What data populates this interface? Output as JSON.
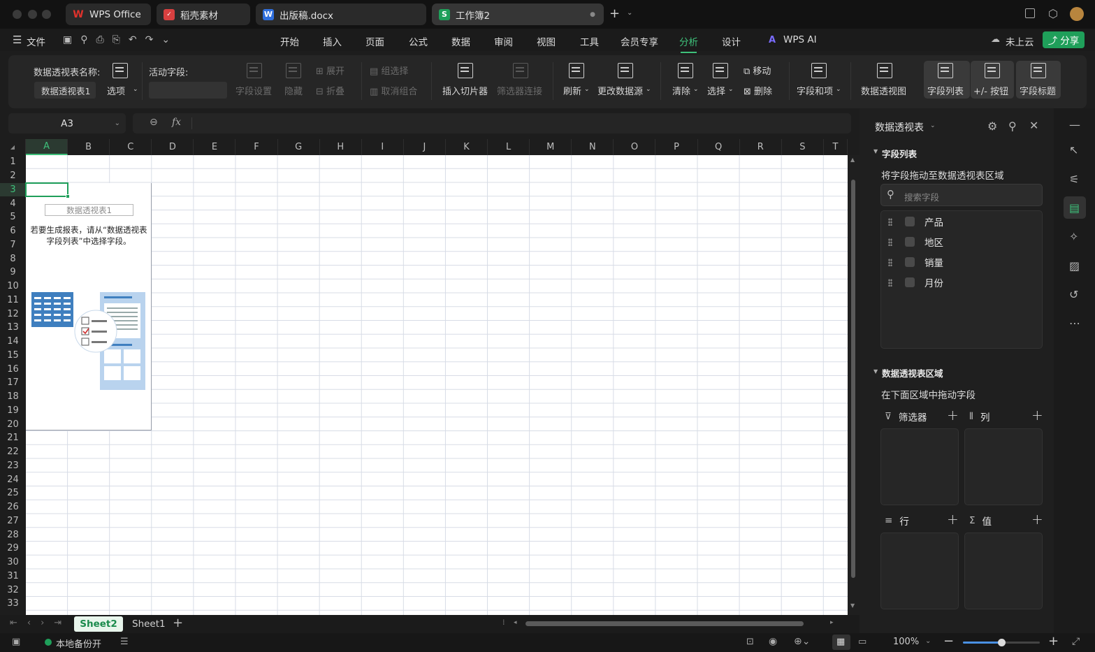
{
  "titlebar": {
    "tabs": [
      {
        "icon": "W",
        "label": "WPS Office",
        "color": "#e0322c"
      },
      {
        "icon": "稻",
        "label": "稻壳素材",
        "color": "#d84040"
      },
      {
        "icon": "W",
        "label": "出版稿.docx",
        "color": "#2f6fde"
      },
      {
        "icon": "S",
        "label": "工作簿2",
        "color": "#1f9f5a"
      }
    ],
    "new_tab": "+"
  },
  "menu": {
    "file": "文件",
    "items": [
      "开始",
      "插入",
      "页面",
      "公式",
      "数据",
      "审阅",
      "视图",
      "工具",
      "会员专享",
      "分析",
      "设计"
    ],
    "active": "分析",
    "ai": "WPS AI",
    "cloud": "未上云",
    "share": "分享"
  },
  "ribbon": {
    "pivot_name_label": "数据透视表名称:",
    "pivot_name_value": "数据透视表1",
    "options": "选项",
    "active_field_label": "活动字段:",
    "field_settings": "字段设置",
    "hide": "隐藏",
    "expand": "展开",
    "collapse": "折叠",
    "group_select": "组选择",
    "ungroup": "取消组合",
    "insert_slicer": "插入切片器",
    "filter_conn": "筛选器连接",
    "refresh": "刷新",
    "change_source": "更改数据源",
    "clear": "清除",
    "select": "选择",
    "move": "移动",
    "delete": "删除",
    "fields_items": "字段和项",
    "pivot_chart": "数据透视图",
    "field_list": "字段列表",
    "plus_minus": "+/- 按钮",
    "field_headers": "字段标题"
  },
  "formula": {
    "cell": "A3",
    "fx": "fx"
  },
  "grid": {
    "columns": [
      "A",
      "B",
      "C",
      "D",
      "E",
      "F",
      "G",
      "H",
      "I",
      "J",
      "K",
      "L",
      "M",
      "N",
      "O",
      "P",
      "Q",
      "R",
      "S",
      "T"
    ],
    "rows": [
      "1",
      "2",
      "3",
      "4",
      "5",
      "6",
      "7",
      "8",
      "9",
      "10",
      "11",
      "12",
      "13",
      "14",
      "15",
      "16",
      "17",
      "18",
      "19",
      "20",
      "21",
      "22",
      "23",
      "24",
      "25",
      "26",
      "27",
      "28",
      "29",
      "30",
      "31",
      "32",
      "33"
    ],
    "pivot_name": "数据透视表1",
    "pivot_tip": "若要生成报表，请从“数据透视表字段列表”中选择字段。"
  },
  "sheets": {
    "tabs": [
      "Sheet2",
      "Sheet1"
    ],
    "active": "Sheet2"
  },
  "status": {
    "backup": "本地备份开",
    "zoom": "100%",
    "zoom_level": 0.5
  },
  "panel": {
    "title": "数据透视表",
    "field_section": "字段列表",
    "field_hint": "将字段拖动至数据透视表区域",
    "search_placeholder": "搜索字段",
    "fields": [
      "产品",
      "地区",
      "销量",
      "月份"
    ],
    "area_section": "数据透视表区域",
    "area_hint": "在下面区域中拖动字段",
    "zones": {
      "filter": "筛选器",
      "column": "列",
      "row": "行",
      "value": "值"
    }
  }
}
